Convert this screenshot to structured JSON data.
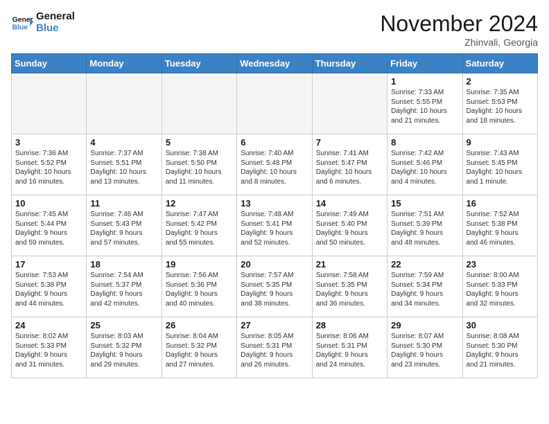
{
  "header": {
    "logo_line1": "General",
    "logo_line2": "Blue",
    "month": "November 2024",
    "location": "Zhinvali, Georgia"
  },
  "days_of_week": [
    "Sunday",
    "Monday",
    "Tuesday",
    "Wednesday",
    "Thursday",
    "Friday",
    "Saturday"
  ],
  "weeks": [
    [
      {
        "day": "",
        "info": ""
      },
      {
        "day": "",
        "info": ""
      },
      {
        "day": "",
        "info": ""
      },
      {
        "day": "",
        "info": ""
      },
      {
        "day": "",
        "info": ""
      },
      {
        "day": "1",
        "info": "Sunrise: 7:33 AM\nSunset: 5:55 PM\nDaylight: 10 hours\nand 21 minutes."
      },
      {
        "day": "2",
        "info": "Sunrise: 7:35 AM\nSunset: 5:53 PM\nDaylight: 10 hours\nand 18 minutes."
      }
    ],
    [
      {
        "day": "3",
        "info": "Sunrise: 7:36 AM\nSunset: 5:52 PM\nDaylight: 10 hours\nand 16 minutes."
      },
      {
        "day": "4",
        "info": "Sunrise: 7:37 AM\nSunset: 5:51 PM\nDaylight: 10 hours\nand 13 minutes."
      },
      {
        "day": "5",
        "info": "Sunrise: 7:38 AM\nSunset: 5:50 PM\nDaylight: 10 hours\nand 11 minutes."
      },
      {
        "day": "6",
        "info": "Sunrise: 7:40 AM\nSunset: 5:48 PM\nDaylight: 10 hours\nand 8 minutes."
      },
      {
        "day": "7",
        "info": "Sunrise: 7:41 AM\nSunset: 5:47 PM\nDaylight: 10 hours\nand 6 minutes."
      },
      {
        "day": "8",
        "info": "Sunrise: 7:42 AM\nSunset: 5:46 PM\nDaylight: 10 hours\nand 4 minutes."
      },
      {
        "day": "9",
        "info": "Sunrise: 7:43 AM\nSunset: 5:45 PM\nDaylight: 10 hours\nand 1 minute."
      }
    ],
    [
      {
        "day": "10",
        "info": "Sunrise: 7:45 AM\nSunset: 5:44 PM\nDaylight: 9 hours\nand 59 minutes."
      },
      {
        "day": "11",
        "info": "Sunrise: 7:46 AM\nSunset: 5:43 PM\nDaylight: 9 hours\nand 57 minutes."
      },
      {
        "day": "12",
        "info": "Sunrise: 7:47 AM\nSunset: 5:42 PM\nDaylight: 9 hours\nand 55 minutes."
      },
      {
        "day": "13",
        "info": "Sunrise: 7:48 AM\nSunset: 5:41 PM\nDaylight: 9 hours\nand 52 minutes."
      },
      {
        "day": "14",
        "info": "Sunrise: 7:49 AM\nSunset: 5:40 PM\nDaylight: 9 hours\nand 50 minutes."
      },
      {
        "day": "15",
        "info": "Sunrise: 7:51 AM\nSunset: 5:39 PM\nDaylight: 9 hours\nand 48 minutes."
      },
      {
        "day": "16",
        "info": "Sunrise: 7:52 AM\nSunset: 5:38 PM\nDaylight: 9 hours\nand 46 minutes."
      }
    ],
    [
      {
        "day": "17",
        "info": "Sunrise: 7:53 AM\nSunset: 5:38 PM\nDaylight: 9 hours\nand 44 minutes."
      },
      {
        "day": "18",
        "info": "Sunrise: 7:54 AM\nSunset: 5:37 PM\nDaylight: 9 hours\nand 42 minutes."
      },
      {
        "day": "19",
        "info": "Sunrise: 7:56 AM\nSunset: 5:36 PM\nDaylight: 9 hours\nand 40 minutes."
      },
      {
        "day": "20",
        "info": "Sunrise: 7:57 AM\nSunset: 5:35 PM\nDaylight: 9 hours\nand 38 minutes."
      },
      {
        "day": "21",
        "info": "Sunrise: 7:58 AM\nSunset: 5:35 PM\nDaylight: 9 hours\nand 36 minutes."
      },
      {
        "day": "22",
        "info": "Sunrise: 7:59 AM\nSunset: 5:34 PM\nDaylight: 9 hours\nand 34 minutes."
      },
      {
        "day": "23",
        "info": "Sunrise: 8:00 AM\nSunset: 5:33 PM\nDaylight: 9 hours\nand 32 minutes."
      }
    ],
    [
      {
        "day": "24",
        "info": "Sunrise: 8:02 AM\nSunset: 5:33 PM\nDaylight: 9 hours\nand 31 minutes."
      },
      {
        "day": "25",
        "info": "Sunrise: 8:03 AM\nSunset: 5:32 PM\nDaylight: 9 hours\nand 29 minutes."
      },
      {
        "day": "26",
        "info": "Sunrise: 8:04 AM\nSunset: 5:32 PM\nDaylight: 9 hours\nand 27 minutes."
      },
      {
        "day": "27",
        "info": "Sunrise: 8:05 AM\nSunset: 5:31 PM\nDaylight: 9 hours\nand 26 minutes."
      },
      {
        "day": "28",
        "info": "Sunrise: 8:06 AM\nSunset: 5:31 PM\nDaylight: 9 hours\nand 24 minutes."
      },
      {
        "day": "29",
        "info": "Sunrise: 8:07 AM\nSunset: 5:30 PM\nDaylight: 9 hours\nand 23 minutes."
      },
      {
        "day": "30",
        "info": "Sunrise: 8:08 AM\nSunset: 5:30 PM\nDaylight: 9 hours\nand 21 minutes."
      }
    ]
  ]
}
